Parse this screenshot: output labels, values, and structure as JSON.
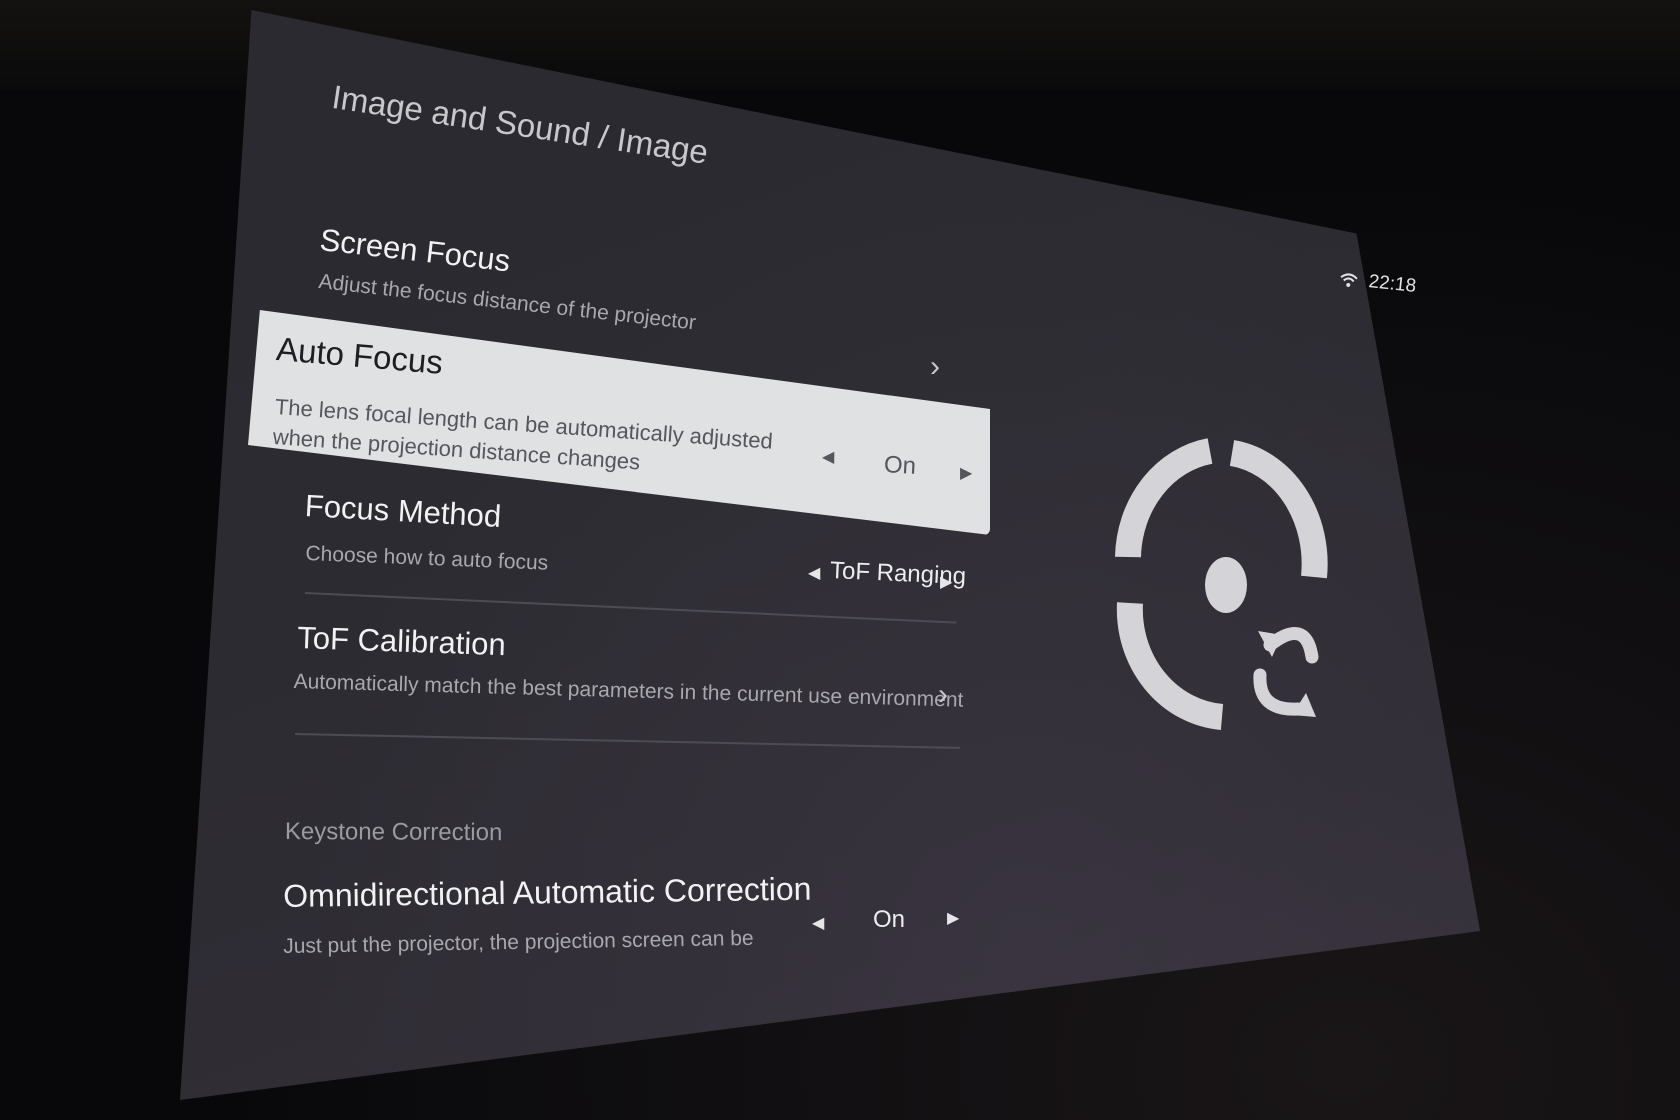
{
  "breadcrumb": "Image and Sound / Image",
  "status": {
    "time": "22:18",
    "wifi_icon": "wifi-icon"
  },
  "items": {
    "screen_focus": {
      "title": "Screen Focus",
      "description": "Adjust the focus distance of the projector"
    },
    "auto_focus": {
      "title": "Auto Focus",
      "description": "The lens focal length can be automatically adjusted when the projection distance changes",
      "value": "On"
    },
    "focus_method": {
      "title": "Focus Method",
      "description": "Choose how to auto focus",
      "value": "ToF Ranging"
    },
    "tof_calibration": {
      "title": "ToF Calibration",
      "description": "Automatically match the best parameters in the current use environment"
    }
  },
  "keystone": {
    "section_label": "Keystone Correction",
    "omnidirectional": {
      "title": "Omnidirectional Automatic Correction",
      "description": "Just put the projector, the projection screen can be",
      "value": "On"
    }
  },
  "colors": {
    "screen_bg": "#2c2b31",
    "selected_bg": "#dfe1e3",
    "text_primary": "#f2f2f4",
    "text_secondary": "#a8a8ae",
    "graphic": "#d4d4d8"
  },
  "icons": {
    "detail_chevron": "chevron-right-icon",
    "left_arrow": "triangle-left-icon",
    "right_arrow": "triangle-right-icon",
    "focus_graphic": "auto-focus-target-icon"
  }
}
